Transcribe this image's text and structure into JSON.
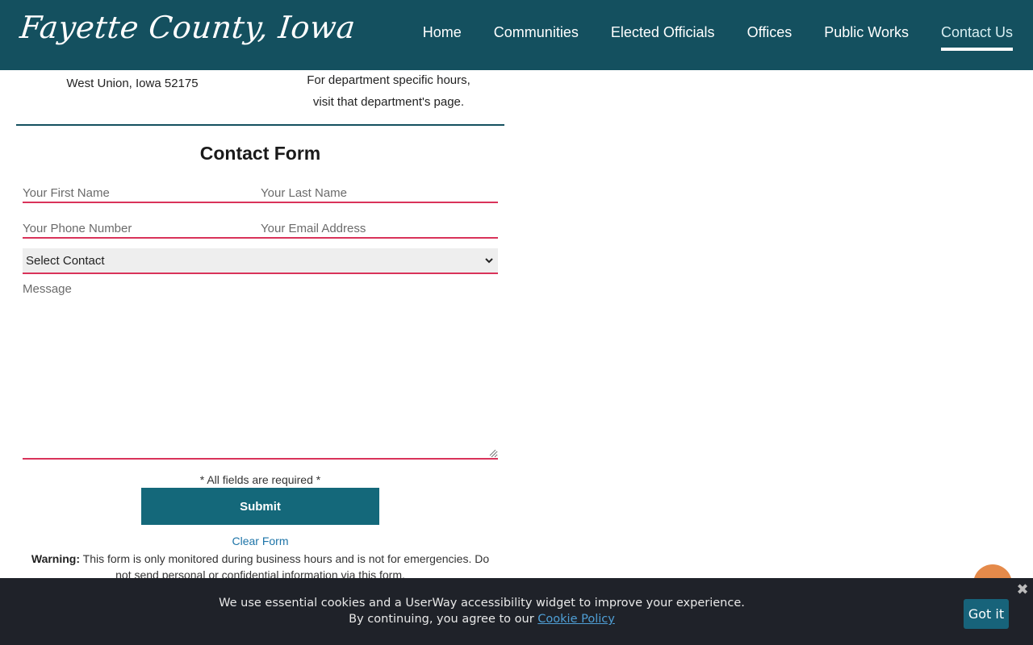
{
  "header": {
    "logo_text": "Fayette County, Iowa",
    "nav": [
      {
        "label": "Home"
      },
      {
        "label": "Communities"
      },
      {
        "label": "Elected Officials"
      },
      {
        "label": "Offices"
      },
      {
        "label": "Public Works"
      },
      {
        "label": "Contact Us",
        "active": true
      }
    ]
  },
  "address": {
    "city_line": "West Union, Iowa 52175",
    "hours_line_1": "For department specific hours,",
    "hours_line_2": "visit that department's page."
  },
  "form": {
    "title": "Contact Form",
    "first_name_placeholder": "Your First Name",
    "last_name_placeholder": "Your Last Name",
    "phone_placeholder": "Your Phone Number",
    "email_placeholder": "Your Email Address",
    "select_value": "Select Contact",
    "message_placeholder": "Message",
    "required_note": "* All fields are required *",
    "submit_label": "Submit",
    "clear_label": "Clear Form",
    "warning_label": "Warning:",
    "warning_text": "This form is only monitored during business hours and is not for emergencies. Do not send personal or confidential information via this form."
  },
  "cookie": {
    "line_1": "We use essential cookies and a UserWay accessibility widget to improve your experience.",
    "line_2_prefix": "By continuing, you agree to our",
    "policy_link": "Cookie Policy",
    "accept_label": "Got it",
    "close_glyph": "✖"
  },
  "colors": {
    "header_bg": "#14505f",
    "accent_red": "#d9335a",
    "button_teal": "#14687a",
    "fab_orange": "#e58a4a",
    "cookie_bg": "#1f2229"
  },
  "icons": {
    "select_chevron": "chevron-down-icon",
    "cookie_close": "close-icon",
    "fab": "accessibility-widget-icon"
  }
}
